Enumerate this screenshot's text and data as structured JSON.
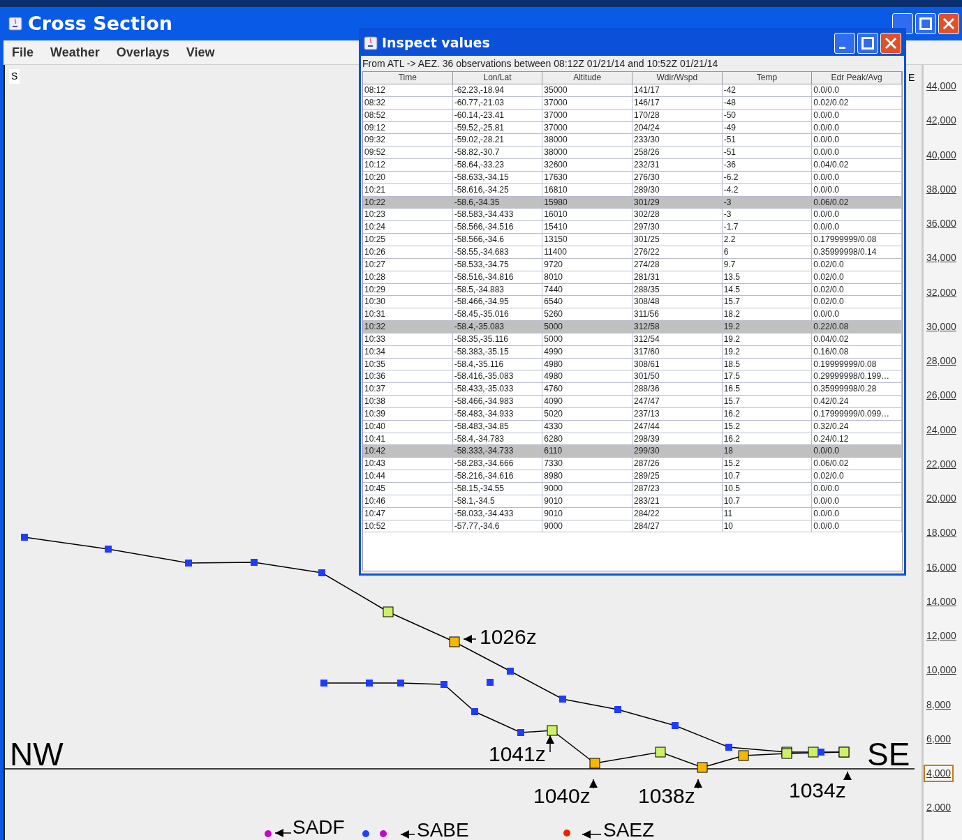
{
  "window": {
    "title": "Cross Section"
  },
  "menu": [
    "File",
    "Weather",
    "Overlays",
    "View"
  ],
  "canvas": {
    "corner_label": "S",
    "edge_label": "E",
    "left_label": "NW",
    "right_label": "SE",
    "time_labels": [
      "1026z",
      "1041z",
      "1040z",
      "1038z",
      "1034z"
    ],
    "stations": [
      "SADF",
      "SABE",
      "SAEZ"
    ],
    "markers": [
      {
        "color": "#cc00cc"
      },
      {
        "color": "#2040ff"
      },
      {
        "color": "#cc00cc"
      },
      {
        "color": "#ee2200"
      }
    ]
  },
  "axis": {
    "ticks": [
      {
        "label": "44,000",
        "highlighted": false
      },
      {
        "label": "42,000",
        "highlighted": false
      },
      {
        "label": "40,000",
        "highlighted": false
      },
      {
        "label": "38,000",
        "highlighted": false
      },
      {
        "label": "36,000",
        "highlighted": false
      },
      {
        "label": "34,000",
        "highlighted": false
      },
      {
        "label": "32,000",
        "highlighted": false
      },
      {
        "label": "30,000",
        "highlighted": false
      },
      {
        "label": "28,000",
        "highlighted": false
      },
      {
        "label": "26,000",
        "highlighted": false
      },
      {
        "label": "24,000",
        "highlighted": false
      },
      {
        "label": "22,000",
        "highlighted": false
      },
      {
        "label": "20,000",
        "highlighted": false
      },
      {
        "label": "18,000",
        "highlighted": false
      },
      {
        "label": "16,000",
        "highlighted": false
      },
      {
        "label": "14,000",
        "highlighted": false
      },
      {
        "label": "12,000",
        "highlighted": false
      },
      {
        "label": "10,000",
        "highlighted": false
      },
      {
        "label": "8,000",
        "highlighted": false
      },
      {
        "label": "6,000",
        "highlighted": false
      },
      {
        "label": "4,000",
        "highlighted": true
      },
      {
        "label": "2,000",
        "highlighted": false
      }
    ]
  },
  "dialog": {
    "title": "Inspect values",
    "summary": "From ATL -> AEZ.  36 observations between 08:12Z 01/21/14 and 10:52Z 01/21/14",
    "columns": [
      "Time",
      "Lon/Lat",
      "Altitude",
      "Wdir/Wspd",
      "Temp",
      "Edr Peak/Avg"
    ],
    "rows": [
      {
        "cells": [
          "08:12",
          "-62.23,-18.94",
          "35000",
          "141/17",
          "-42",
          "0.0/0.0"
        ],
        "selected": false
      },
      {
        "cells": [
          "08:32",
          "-60.77,-21.03",
          "37000",
          "146/17",
          "-48",
          "0.02/0.02"
        ],
        "selected": false
      },
      {
        "cells": [
          "08:52",
          "-60.14,-23.41",
          "37000",
          "170/28",
          "-50",
          "0.0/0.0"
        ],
        "selected": false
      },
      {
        "cells": [
          "09:12",
          "-59.52,-25.81",
          "37000",
          "204/24",
          "-49",
          "0.0/0.0"
        ],
        "selected": false
      },
      {
        "cells": [
          "09:32",
          "-59.02,-28.21",
          "38000",
          "233/30",
          "-51",
          "0.0/0.0"
        ],
        "selected": false
      },
      {
        "cells": [
          "09:52",
          "-58.82,-30.7",
          "38000",
          "258/26",
          "-51",
          "0.0/0.0"
        ],
        "selected": false
      },
      {
        "cells": [
          "10:12",
          "-58.64,-33.23",
          "32600",
          "232/31",
          "-36",
          "0.04/0.02"
        ],
        "selected": false
      },
      {
        "cells": [
          "10:20",
          "-58.633,-34.15",
          "17630",
          "276/30",
          "-6.2",
          "0.0/0.0"
        ],
        "selected": false
      },
      {
        "cells": [
          "10:21",
          "-58.616,-34.25",
          "16810",
          "289/30",
          "-4.2",
          "0.0/0.0"
        ],
        "selected": false
      },
      {
        "cells": [
          "10:22",
          "-58.6,-34.35",
          "15980",
          "301/29",
          "-3",
          "0.06/0.02"
        ],
        "selected": true
      },
      {
        "cells": [
          "10:23",
          "-58.583,-34.433",
          "16010",
          "302/28",
          "-3",
          "0.0/0.0"
        ],
        "selected": false
      },
      {
        "cells": [
          "10:24",
          "-58.566,-34.516",
          "15410",
          "297/30",
          "-1.7",
          "0.0/0.0"
        ],
        "selected": false
      },
      {
        "cells": [
          "10:25",
          "-58.566,-34.6",
          "13150",
          "301/25",
          "2.2",
          "0.17999999/0.08"
        ],
        "selected": false
      },
      {
        "cells": [
          "10:26",
          "-58.55,-34.683",
          "11400",
          "276/22",
          "6",
          "0.35999998/0.14"
        ],
        "selected": false
      },
      {
        "cells": [
          "10:27",
          "-58.533,-34.75",
          "9720",
          "274/28",
          "9.7",
          "0.02/0.0"
        ],
        "selected": false
      },
      {
        "cells": [
          "10:28",
          "-58.516,-34.816",
          "8010",
          "281/31",
          "13.5",
          "0.02/0.0"
        ],
        "selected": false
      },
      {
        "cells": [
          "10:29",
          "-58.5,-34.883",
          "7440",
          "288/35",
          "14.5",
          "0.02/0.0"
        ],
        "selected": false
      },
      {
        "cells": [
          "10:30",
          "-58.466,-34.95",
          "6540",
          "308/48",
          "15.7",
          "0.02/0.0"
        ],
        "selected": false
      },
      {
        "cells": [
          "10:31",
          "-58.45,-35.016",
          "5260",
          "311/56",
          "18.2",
          "0.0/0.0"
        ],
        "selected": false
      },
      {
        "cells": [
          "10:32",
          "-58.4,-35.083",
          "5000",
          "312/58",
          "19.2",
          "0.22/0.08"
        ],
        "selected": true
      },
      {
        "cells": [
          "10:33",
          "-58.35,-35.116",
          "5000",
          "312/54",
          "19.2",
          "0.04/0.02"
        ],
        "selected": false
      },
      {
        "cells": [
          "10:34",
          "-58.383,-35.15",
          "4990",
          "317/60",
          "19.2",
          "0.16/0.08"
        ],
        "selected": false
      },
      {
        "cells": [
          "10:35",
          "-58.4,-35.116",
          "4980",
          "308/61",
          "18.5",
          "0.19999999/0.08"
        ],
        "selected": false
      },
      {
        "cells": [
          "10:36",
          "-58.416,-35.083",
          "4980",
          "301/50",
          "17.5",
          "0.29999998/0.199…"
        ],
        "selected": false
      },
      {
        "cells": [
          "10:37",
          "-58.433,-35.033",
          "4760",
          "288/36",
          "16.5",
          "0.35999998/0.28"
        ],
        "selected": false
      },
      {
        "cells": [
          "10:38",
          "-58.466,-34.983",
          "4090",
          "247/47",
          "15.7",
          "0.42/0.24"
        ],
        "selected": false
      },
      {
        "cells": [
          "10:39",
          "-58.483,-34.933",
          "5020",
          "237/13",
          "16.2",
          "0.17999999/0.099…"
        ],
        "selected": false
      },
      {
        "cells": [
          "10:40",
          "-58.483,-34.85",
          "4330",
          "247/44",
          "15.2",
          "0.32/0.24"
        ],
        "selected": false
      },
      {
        "cells": [
          "10:41",
          "-58.4,-34.783",
          "6280",
          "298/39",
          "16.2",
          "0.24/0.12"
        ],
        "selected": false
      },
      {
        "cells": [
          "10:42",
          "-58.333,-34.733",
          "6110",
          "299/30",
          "18",
          "0.0/0.0"
        ],
        "selected": true
      },
      {
        "cells": [
          "10:43",
          "-58.283,-34.666",
          "7330",
          "287/26",
          "15.2",
          "0.06/0.02"
        ],
        "selected": false
      },
      {
        "cells": [
          "10:44",
          "-58.216,-34.616",
          "8980",
          "289/25",
          "10.7",
          "0.02/0.0"
        ],
        "selected": false
      },
      {
        "cells": [
          "10:45",
          "-58.15,-34.55",
          "9000",
          "287/23",
          "10.5",
          "0.0/0.0"
        ],
        "selected": false
      },
      {
        "cells": [
          "10:46",
          "-58.1,-34.5",
          "9010",
          "283/21",
          "10.7",
          "0.0/0.0"
        ],
        "selected": false
      },
      {
        "cells": [
          "10:47",
          "-58.033,-34.433",
          "9010",
          "284/22",
          "11",
          "0.0/0.0"
        ],
        "selected": false
      },
      {
        "cells": [
          "10:52",
          "-57.77,-34.6",
          "9000",
          "284/27",
          "10",
          "0.0/0.0"
        ],
        "selected": false
      }
    ]
  }
}
